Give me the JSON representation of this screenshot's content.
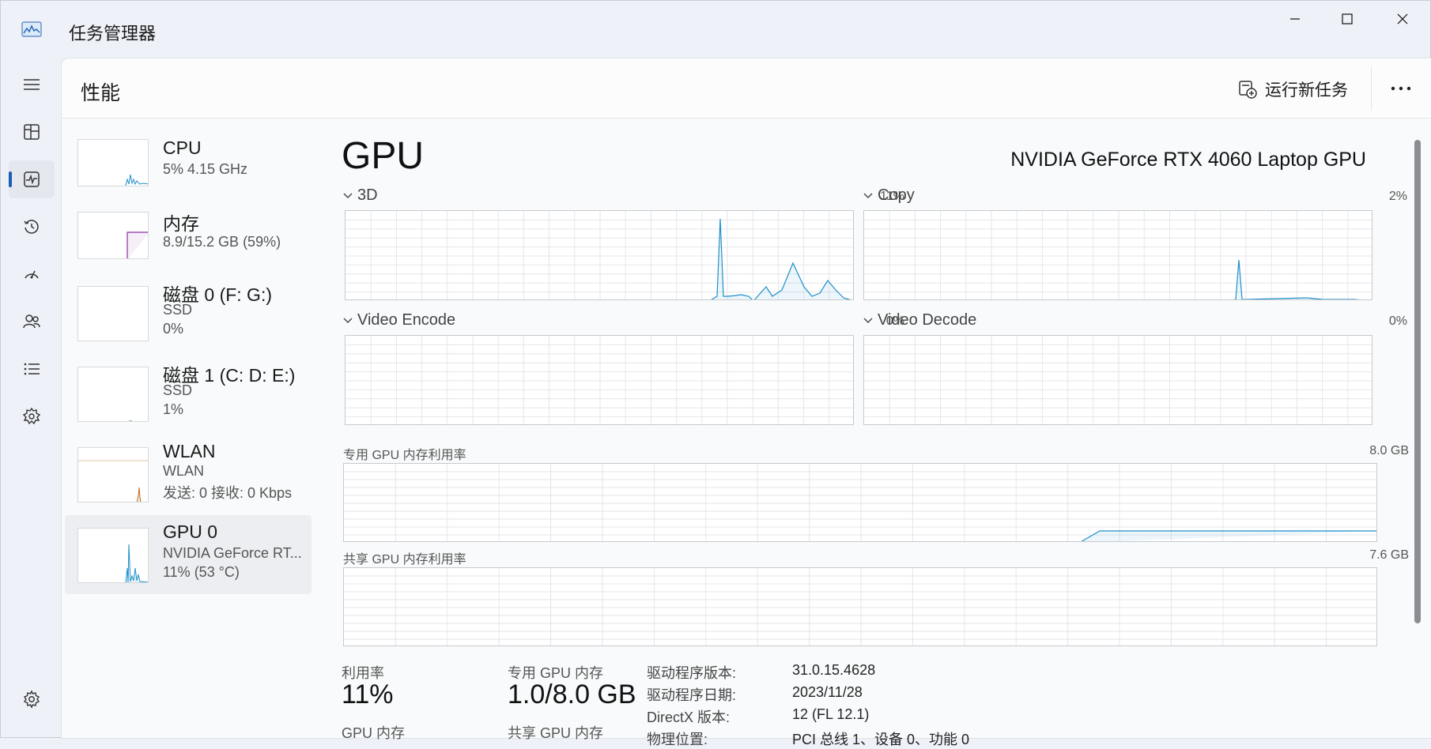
{
  "window": {
    "title": "任务管理器"
  },
  "header": {
    "page_title": "性能",
    "run_new_task": "运行新任务"
  },
  "sidebar": {
    "items": [
      {
        "name": "CPU",
        "sub1": "5%  4.15 GHz",
        "sub2": ""
      },
      {
        "name": "内存",
        "sub1": "8.9/15.2 GB (59%)",
        "sub2": ""
      },
      {
        "name": "磁盘 0 (F: G:)",
        "sub1": "SSD",
        "sub2": "0%"
      },
      {
        "name": "磁盘 1 (C: D: E:)",
        "sub1": "SSD",
        "sub2": "1%"
      },
      {
        "name": "WLAN",
        "sub1": "WLAN",
        "sub2": "发送: 0 接收: 0 Kbps"
      },
      {
        "name": "GPU 0",
        "sub1": "NVIDIA GeForce RT...",
        "sub2": "11%  (53 °C)"
      }
    ]
  },
  "gpu": {
    "title": "GPU",
    "model": "NVIDIA GeForce RTX 4060 Laptop GPU",
    "engines": [
      {
        "label": "3D",
        "pct": "11%"
      },
      {
        "label": "Copy",
        "pct": "2%"
      },
      {
        "label": "Video Encode",
        "pct": "0%"
      },
      {
        "label": "Video Decode",
        "pct": "0%"
      }
    ],
    "dedicated_label": "专用 GPU 内存利用率",
    "dedicated_max": "8.0 GB",
    "shared_label": "共享 GPU 内存利用率",
    "shared_max": "7.6 GB",
    "stats": {
      "util_label": "利用率",
      "util_value": "11%",
      "dedicated_mem_label": "专用 GPU 内存",
      "dedicated_mem_value": "1.0/8.0 GB",
      "gpu_mem_label": "GPU 内存",
      "shared_mem_label": "共享 GPU 内存"
    },
    "info": [
      {
        "k": "驱动程序版本:",
        "v": "31.0.15.4628"
      },
      {
        "k": "驱动程序日期:",
        "v": "2023/11/28"
      },
      {
        "k": "DirectX 版本:",
        "v": "12 (FL 12.1)"
      },
      {
        "k": "物理位置:",
        "v": "PCI 总线 1、设备 0、功能 0"
      }
    ]
  },
  "icons": {
    "nav": [
      "hamburger-icon",
      "processes-icon",
      "performance-icon",
      "app-history-icon",
      "startup-icon",
      "users-icon",
      "details-icon",
      "services-icon",
      "settings-icon"
    ]
  },
  "colors": {
    "accent": "#1a5fb4",
    "graph_line": "#1f8fc9",
    "memory_line": "#8b2fa0",
    "wlan_line": "#c06b1f"
  }
}
